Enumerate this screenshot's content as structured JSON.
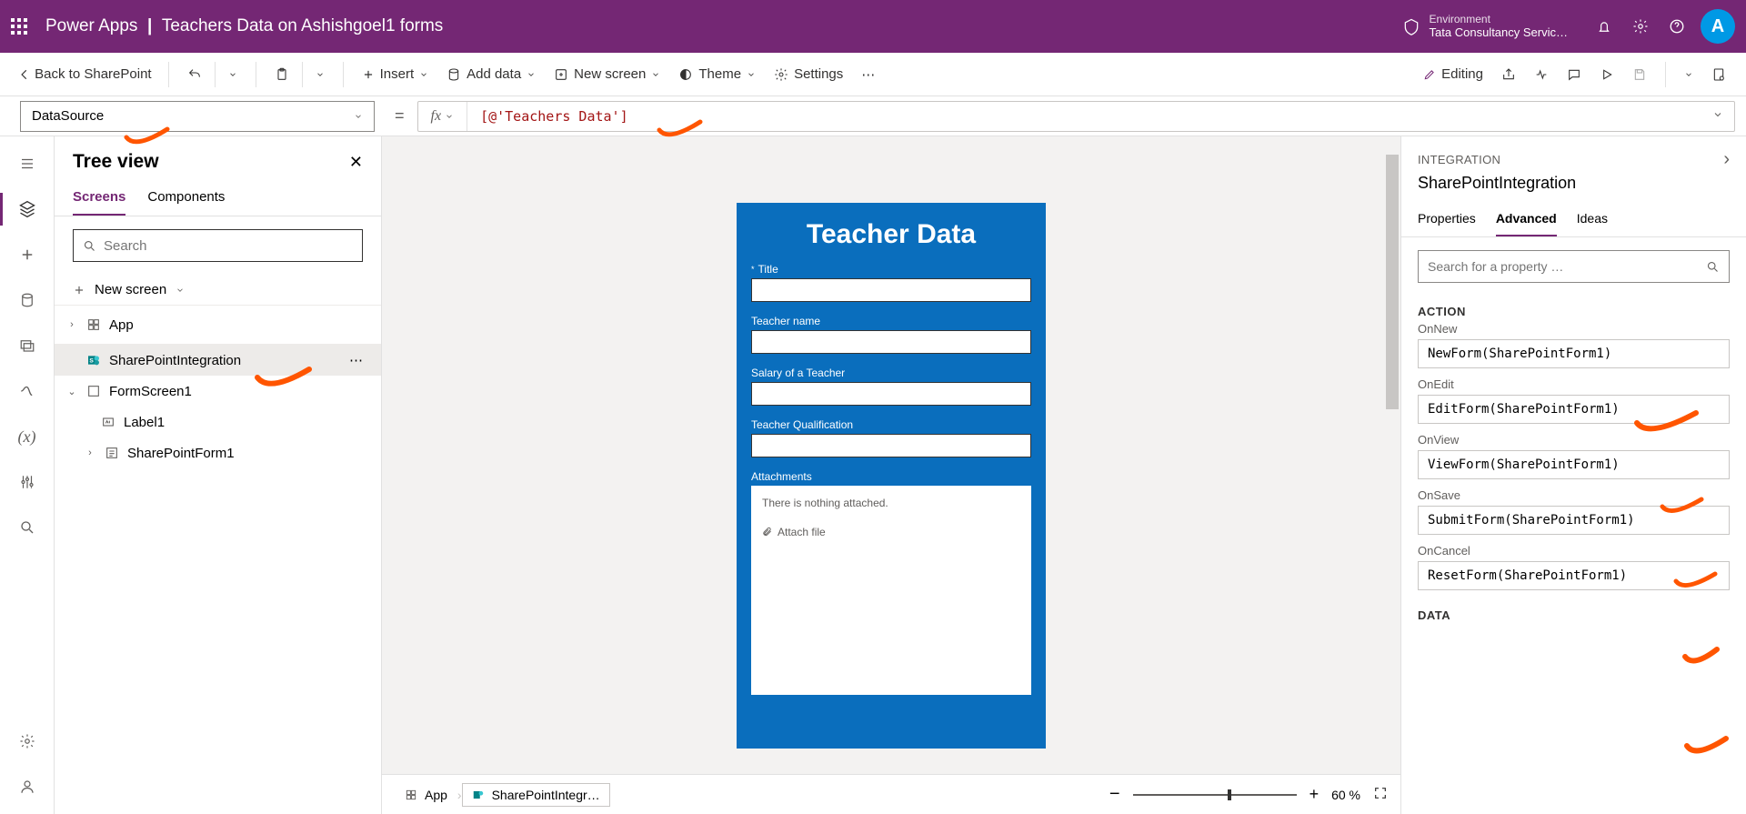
{
  "header": {
    "app": "Power Apps",
    "title": "Teachers Data on Ashishgoel1 forms",
    "envLabel": "Environment",
    "envName": "Tata Consultancy Servic…",
    "avatar": "A"
  },
  "toolbar": {
    "back": "Back to SharePoint",
    "insert": "Insert",
    "addData": "Add data",
    "newScreen": "New screen",
    "theme": "Theme",
    "settings": "Settings",
    "editing": "Editing"
  },
  "formula": {
    "property": "DataSource",
    "value": "[@'Teachers Data']"
  },
  "tree": {
    "title": "Tree view",
    "tabs": {
      "screens": "Screens",
      "components": "Components"
    },
    "searchPh": "Search",
    "newScreen": "New screen",
    "items": {
      "app": "App",
      "spi": "SharePointIntegration",
      "fs": "FormScreen1",
      "lbl": "Label1",
      "spf": "SharePointForm1"
    }
  },
  "canvasForm": {
    "heading": "Teacher Data",
    "fields": {
      "title": "Title",
      "name": "Teacher name",
      "salary": "Salary of a Teacher",
      "qual": "Teacher Qualification",
      "attach": "Attachments"
    },
    "attachEmpty": "There is nothing attached.",
    "attachFile": "Attach file"
  },
  "breadcrumb": {
    "app": "App",
    "spi": "SharePointIntegr…"
  },
  "zoom": {
    "pct": "60",
    "pctLabel": "%"
  },
  "propsPanel": {
    "cat": "INTEGRATION",
    "name": "SharePointIntegration",
    "tabs": {
      "props": "Properties",
      "adv": "Advanced",
      "ideas": "Ideas"
    },
    "searchPh": "Search for a property …",
    "sectionAction": "ACTION",
    "sectionData": "DATA",
    "actions": {
      "OnNew": {
        "label": "OnNew",
        "value": "NewForm(SharePointForm1)"
      },
      "OnEdit": {
        "label": "OnEdit",
        "value": "EditForm(SharePointForm1)"
      },
      "OnView": {
        "label": "OnView",
        "value": "ViewForm(SharePointForm1)"
      },
      "OnSave": {
        "label": "OnSave",
        "value": "SubmitForm(SharePointForm1)"
      },
      "OnCancel": {
        "label": "OnCancel",
        "value": "ResetForm(SharePointForm1)"
      }
    }
  }
}
